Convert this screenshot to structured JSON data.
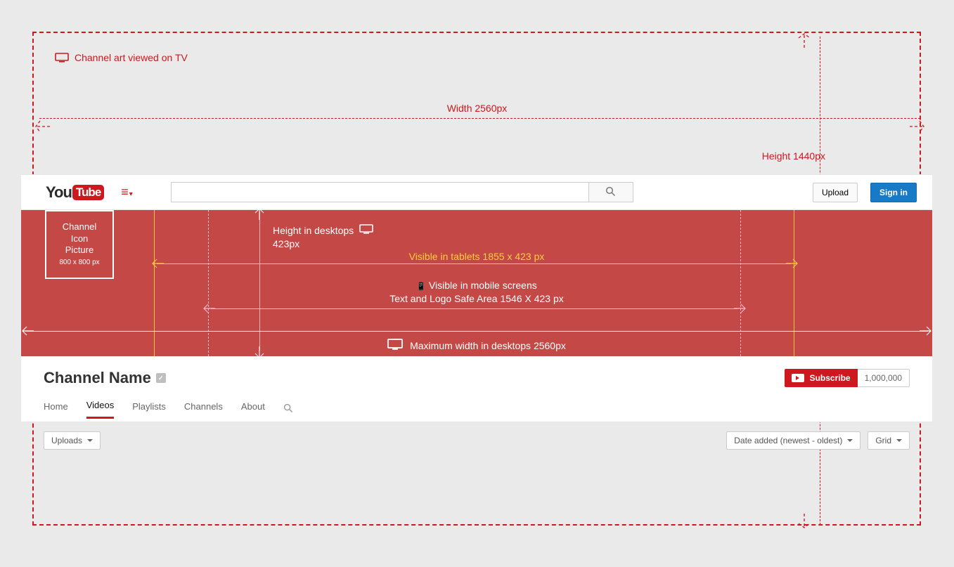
{
  "tv": {
    "caption": "Channel art viewed on TV",
    "width_label": "Width  2560px",
    "height_label": "Height   1440px"
  },
  "topbar": {
    "logo_you": "You",
    "logo_tube": "Tube",
    "upload": "Upload",
    "signin": "Sign in"
  },
  "banner": {
    "icon_l1": "Channel",
    "icon_l2": "Icon",
    "icon_l3": "Picture",
    "icon_dim": "800 x 800 px",
    "hd_l1": "Height in desktops",
    "hd_l2": "423px",
    "tablet": "Visible in tablets  1855 x 423 px",
    "mobile_l1": "Visible in mobile screens",
    "mobile_l2": "Text and Logo Safe Area   1546 X 423 px",
    "maxw": "Maximum width in desktops  2560px"
  },
  "channel": {
    "name": "Channel Name",
    "subscribe": "Subscribe",
    "subs": "1,000,000",
    "tabs": {
      "home": "Home",
      "videos": "Videos",
      "playlists": "Playlists",
      "channels": "Channels",
      "about": "About"
    }
  },
  "filters": {
    "uploads": "Uploads",
    "sort": "Date added (newest - oldest)",
    "grid": "Grid"
  },
  "icons": {
    "mobile": "📱"
  }
}
